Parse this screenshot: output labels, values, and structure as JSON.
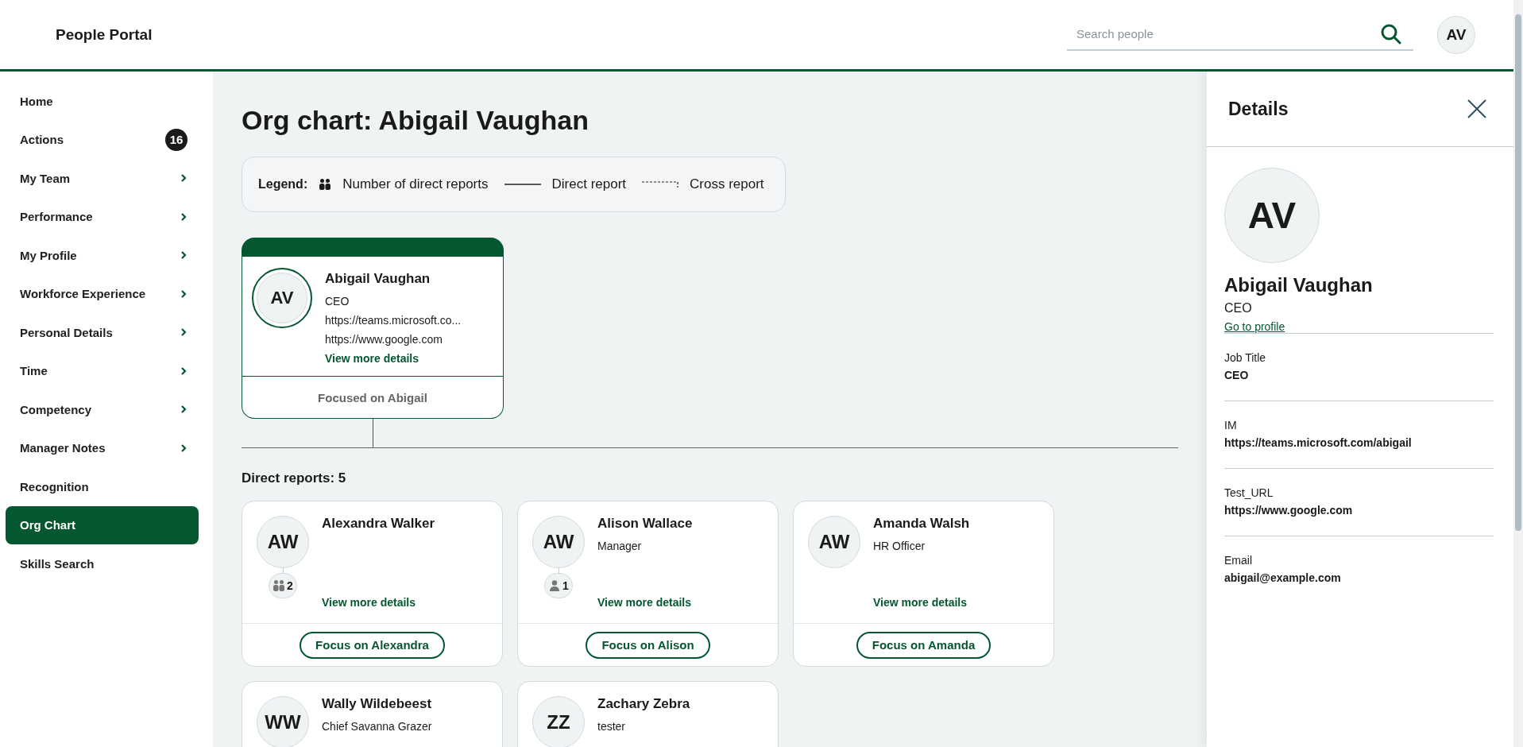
{
  "header": {
    "title": "People Portal",
    "search": {
      "placeholder": "Search people"
    },
    "user_initials": "AV"
  },
  "sidebar": {
    "items": [
      {
        "label": "Home",
        "has_submenu": false,
        "selected": false
      },
      {
        "label": "Actions",
        "has_submenu": false,
        "selected": false,
        "badge": "16"
      },
      {
        "label": "My Team",
        "has_submenu": true,
        "selected": false
      },
      {
        "label": "Performance",
        "has_submenu": true,
        "selected": false
      },
      {
        "label": "My Profile",
        "has_submenu": true,
        "selected": false
      },
      {
        "label": "Workforce Experience",
        "has_submenu": true,
        "selected": false
      },
      {
        "label": "Personal Details",
        "has_submenu": true,
        "selected": false
      },
      {
        "label": "Time",
        "has_submenu": true,
        "selected": false
      },
      {
        "label": "Competency",
        "has_submenu": true,
        "selected": false
      },
      {
        "label": "Manager Notes",
        "has_submenu": true,
        "selected": false
      },
      {
        "label": "Recognition",
        "has_submenu": false,
        "selected": false
      },
      {
        "label": "Org Chart",
        "has_submenu": false,
        "selected": true
      },
      {
        "label": "Skills Search",
        "has_submenu": false,
        "selected": false
      }
    ]
  },
  "main": {
    "title": "Org chart: Abigail Vaughan",
    "legend": {
      "label": "Legend:",
      "items": [
        {
          "kind": "reports",
          "text": "Number of direct reports"
        },
        {
          "kind": "solid",
          "text": "Direct report"
        },
        {
          "kind": "dashed",
          "text": "Cross report"
        }
      ]
    },
    "focus_card": {
      "initials": "AV",
      "name": "Abigail Vaughan",
      "lines": [
        "CEO",
        "https://teams.microsoft.co...",
        "https://www.google.com"
      ],
      "link": "View more details",
      "footer": "Focused on Abigail"
    },
    "direct_reports_heading": "Direct reports: 5",
    "reports": [
      {
        "initials": "AW",
        "name": "Alexandra Walker",
        "reports": {
          "kind": "group",
          "count": "2"
        },
        "link": "View more details",
        "button": "Focus on Alexandra"
      },
      {
        "initials": "AW",
        "name": "Alison Wallace",
        "title": "Manager",
        "reports": {
          "kind": "person",
          "count": "1"
        },
        "link": "View more details",
        "button": "Focus on Alison"
      },
      {
        "initials": "AW",
        "name": "Amanda Walsh",
        "title": "HR Officer",
        "link": "View more details",
        "button": "Focus on Amanda"
      },
      {
        "initials": "WW",
        "name": "Wally Wildebeest",
        "title": "Chief Savanna Grazer"
      },
      {
        "initials": "ZZ",
        "name": "Zachary Zebra",
        "title": "tester"
      }
    ]
  },
  "details": {
    "title": "Details",
    "initials": "AV",
    "name": "Abigail Vaughan",
    "role": "CEO",
    "link": "Go to profile",
    "fields": [
      {
        "label": "Job Title",
        "value": "CEO"
      },
      {
        "label": "IM",
        "value": "https://teams.microsoft.com/abigail"
      },
      {
        "label": "Test_URL",
        "value": "https://www.google.com"
      },
      {
        "label": "Email",
        "value": "abigail@example.com"
      }
    ]
  }
}
